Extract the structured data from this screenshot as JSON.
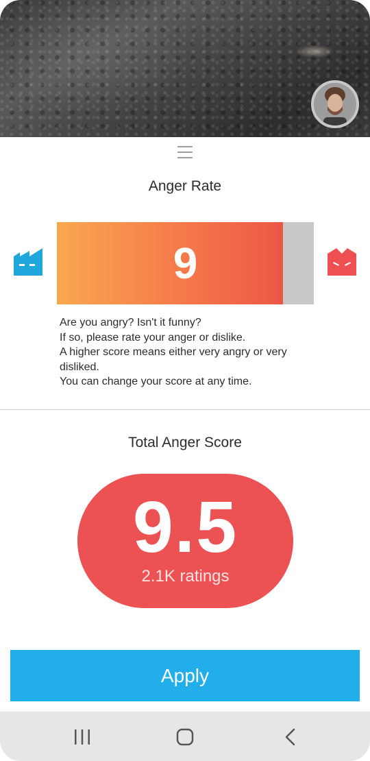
{
  "header": {
    "photo": "blurred-asphalt-photo",
    "avatar_icon": "user-avatar-icon"
  },
  "drag_handle_icon": "hamburger-icon",
  "anger_rate": {
    "title": "Anger Rate",
    "value": "9",
    "fill_fraction": 0.88,
    "left_icon": "calm-face-icon",
    "left_icon_color": "#1fa7db",
    "right_icon": "angry-face-icon",
    "right_icon_color": "#ee4f52",
    "bar_gradient": [
      "#f9a74f",
      "#ec5745"
    ],
    "track_color": "#c8c8c8"
  },
  "description": {
    "lines": [
      "Are you angry? Isn't it funny?",
      "If so, please rate your anger or dislike.",
      "A higher score means either very angry or very disliked.",
      "You can change your score at any time."
    ]
  },
  "total": {
    "title": "Total Anger Score",
    "score": "9.5",
    "ratings": "2.1K ratings",
    "pill_color": "#ec5153"
  },
  "apply": {
    "label": "Apply",
    "color": "#21aeea"
  },
  "nav": {
    "recent_icon": "recent-apps-icon",
    "home_icon": "home-icon",
    "back_icon": "back-chevron-icon"
  }
}
